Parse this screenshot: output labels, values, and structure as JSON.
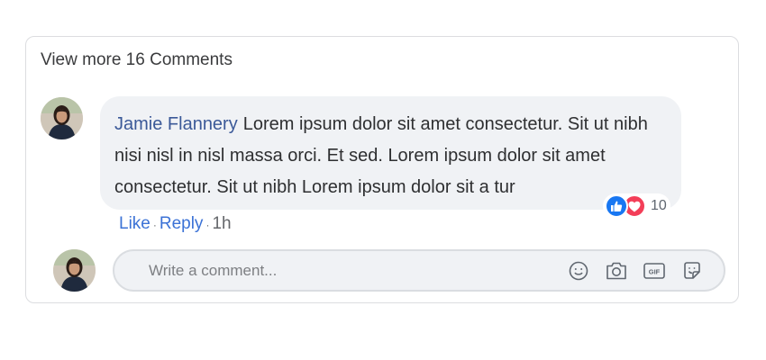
{
  "header": {
    "view_more_label": "View more 16 Comments"
  },
  "comment": {
    "author": "Jamie Flannery",
    "text": "Lorem ipsum dolor sit amet consectetur. Sit ut nibh nisi nisl in nisl massa orci. Et sed. Lorem ipsum dolor sit amet consectetur. Sit ut nibh Lorem ipsum dolor sit a tur",
    "reactions": {
      "types": [
        "like-icon",
        "love-icon"
      ],
      "count": "10",
      "like_color": "#1877f2",
      "love_color": "#f33e58"
    },
    "actions": {
      "like_label": "Like",
      "reply_label": "Reply",
      "separator": "·",
      "time": "1h"
    }
  },
  "composer": {
    "placeholder": "Write a comment...",
    "tools": [
      "emoji-icon",
      "camera-icon",
      "gif-icon",
      "sticker-icon"
    ]
  },
  "colors": {
    "author": "#3b5998",
    "action_link": "#3b72d6",
    "bubble_bg": "#f0f2f5"
  }
}
